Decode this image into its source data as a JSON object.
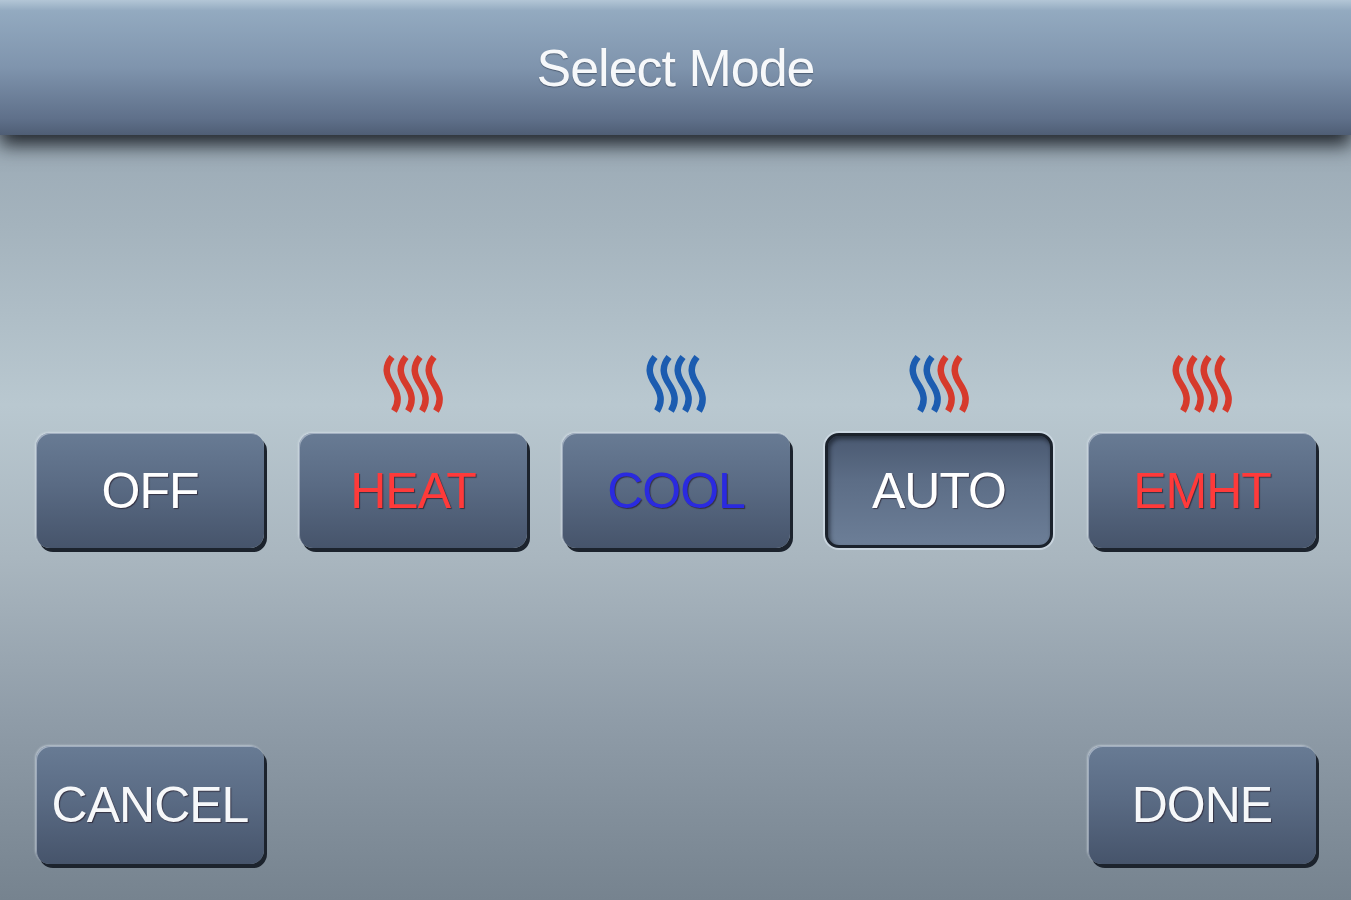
{
  "header": {
    "title": "Select Mode"
  },
  "modes": [
    {
      "label": "OFF",
      "kind": "off",
      "selected": false
    },
    {
      "label": "HEAT",
      "kind": "heat",
      "selected": false
    },
    {
      "label": "COOL",
      "kind": "cool",
      "selected": false
    },
    {
      "label": "AUTO",
      "kind": "auto",
      "selected": true
    },
    {
      "label": "EMHT",
      "kind": "emht",
      "selected": false
    }
  ],
  "actions": [
    "CANCEL",
    "DONE"
  ]
}
